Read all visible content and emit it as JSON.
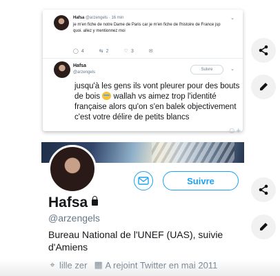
{
  "tweet1": {
    "name": "Hafsa",
    "meta": "@arzengels · 16 min",
    "text": "je m'en fiche de notre Dame de Paris car je m'en fiche de l'histoire de France jsp quoi. allez y mentionnez moi",
    "reply_count": "4",
    "retweet_count": "2",
    "like_count": "3"
  },
  "tweet2": {
    "name": "Hafsa",
    "handle": "@arzengels",
    "follow_label": "Suivre",
    "text_before_emoji": "jusqu'à les gens ils vont pleurer pour des bouts de bois",
    "text_after_emoji": "wallah vs aimez trop l'identité française alors qu'on s'en balek objectivement c'est votre délire de petits blancs"
  },
  "profile": {
    "name": "Hafsa",
    "handle": "@arzengels",
    "follow_label": "Suivre",
    "bio": "Bureau National de l'UNEF (UAS), suivie d'Amiens",
    "location": "lille zer",
    "joined": "A rejoint Twitter en mai 2011"
  },
  "icons": {
    "reply": "reply-icon",
    "retweet": "retweet-icon",
    "like": "heart-icon",
    "share": "share-icon",
    "edit": "pencil-icon",
    "location": "location-pin-icon",
    "calendar": "calendar-icon",
    "mail": "mail-icon",
    "lock": "lock-icon"
  },
  "colors": {
    "accent": "#1da1f2",
    "secondary_text": "#657786"
  }
}
